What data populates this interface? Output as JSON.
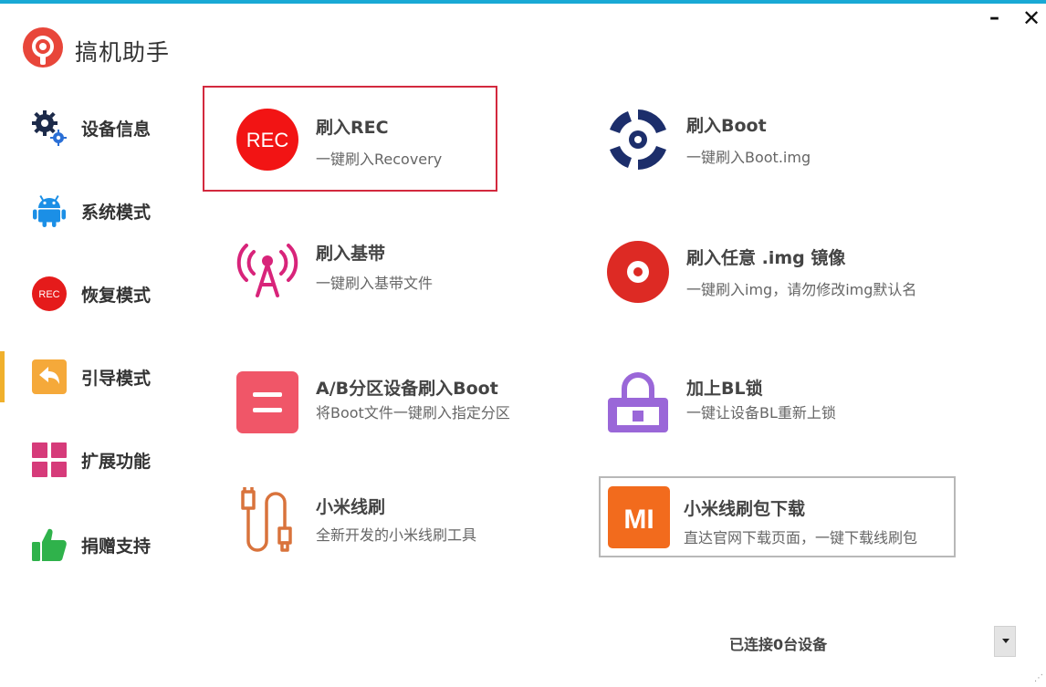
{
  "window": {
    "minimize_glyph": "–",
    "close_glyph": "✕"
  },
  "app": {
    "title": "搞机助手",
    "logo_icon": "record-logo-icon"
  },
  "colors": {
    "accent": "#19a9d5",
    "active_marker": "#f0b02c",
    "selected_border": "#d3293e"
  },
  "sidebar": {
    "items": [
      {
        "label": "设备信息",
        "icon": "gears-icon"
      },
      {
        "label": "系统模式",
        "icon": "android-icon"
      },
      {
        "label": "恢复模式",
        "icon": "rec-icon",
        "icon_text": "REC"
      },
      {
        "label": "引导模式",
        "icon": "back-arrow-icon",
        "active": true
      },
      {
        "label": "扩展功能",
        "icon": "grid-icon"
      },
      {
        "label": "捐赠支持",
        "icon": "thumbs-up-icon"
      }
    ]
  },
  "cards": [
    {
      "title": "刷入REC",
      "desc": "一键刷入Recovery",
      "icon": "rec-icon",
      "icon_text": "REC"
    },
    {
      "title": "刷入Boot",
      "desc": "一键刷入Boot.img",
      "icon": "boot-disc-icon"
    },
    {
      "title": "刷入基带",
      "desc": "一键刷入基带文件",
      "icon": "antenna-icon"
    },
    {
      "title": "刷入任意 .img 镜像",
      "desc": "一键刷入img，请勿修改img默认名",
      "icon": "disc-icon"
    },
    {
      "title": "A/B分区设备刷入Boot",
      "desc": "将Boot文件一键刷入指定分区",
      "icon": "partition-icon"
    },
    {
      "title": "加上BL锁",
      "desc": "一键让设备BL重新上锁",
      "icon": "lock-icon"
    },
    {
      "title": "小米线刷",
      "desc": "全新开发的小米线刷工具",
      "icon": "usb-cable-icon"
    },
    {
      "title": "小米线刷包下载",
      "desc": "直达官网下载页面，一键下载线刷包",
      "icon": "mi-logo-icon",
      "icon_text": "MI"
    }
  ],
  "status": {
    "text": "已连接0台设备"
  }
}
